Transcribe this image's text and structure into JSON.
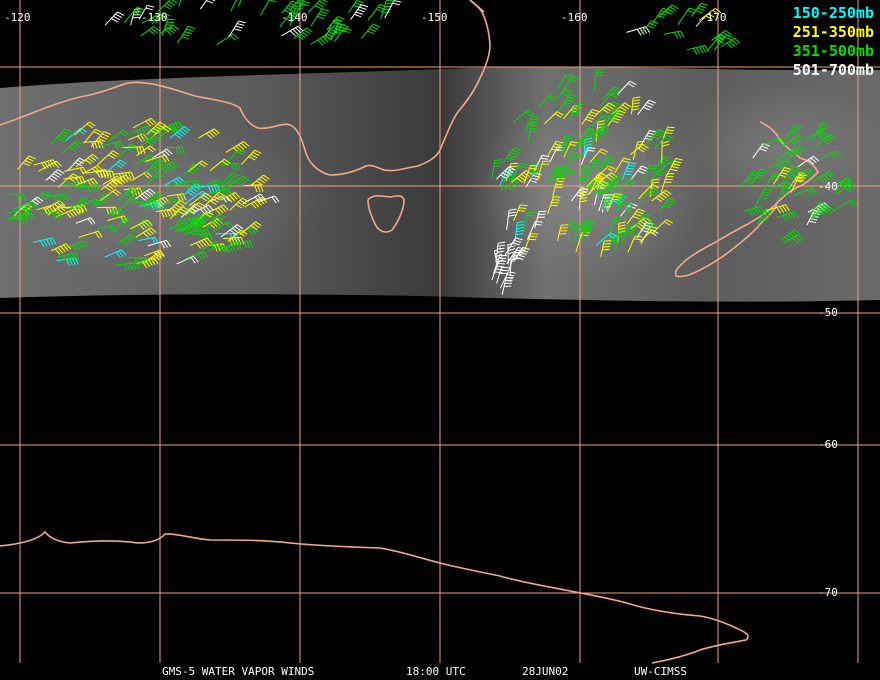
{
  "longitude_labels": [
    "-120",
    "-130",
    "-140",
    "-150",
    "-160",
    "-170"
  ],
  "latitude_labels": [
    "-40",
    "-50",
    "-60",
    "-70"
  ],
  "legend": [
    {
      "label": "150-250mb",
      "color": "#00ffff"
    },
    {
      "label": "251-350mb",
      "color": "#ffff00"
    },
    {
      "label": "351-500mb",
      "color": "#00e000"
    },
    {
      "label": "501-700mb",
      "color": "#ffffff"
    }
  ],
  "footer": {
    "product": "GMS-5 WATER VAPOR WINDS",
    "time": "18:00 UTC",
    "date": "28JUN02",
    "source": "UW-CIMSS"
  },
  "colors": {
    "grid": "#f0a07a",
    "coastline": "#f3a88a",
    "background": "#000000"
  }
}
